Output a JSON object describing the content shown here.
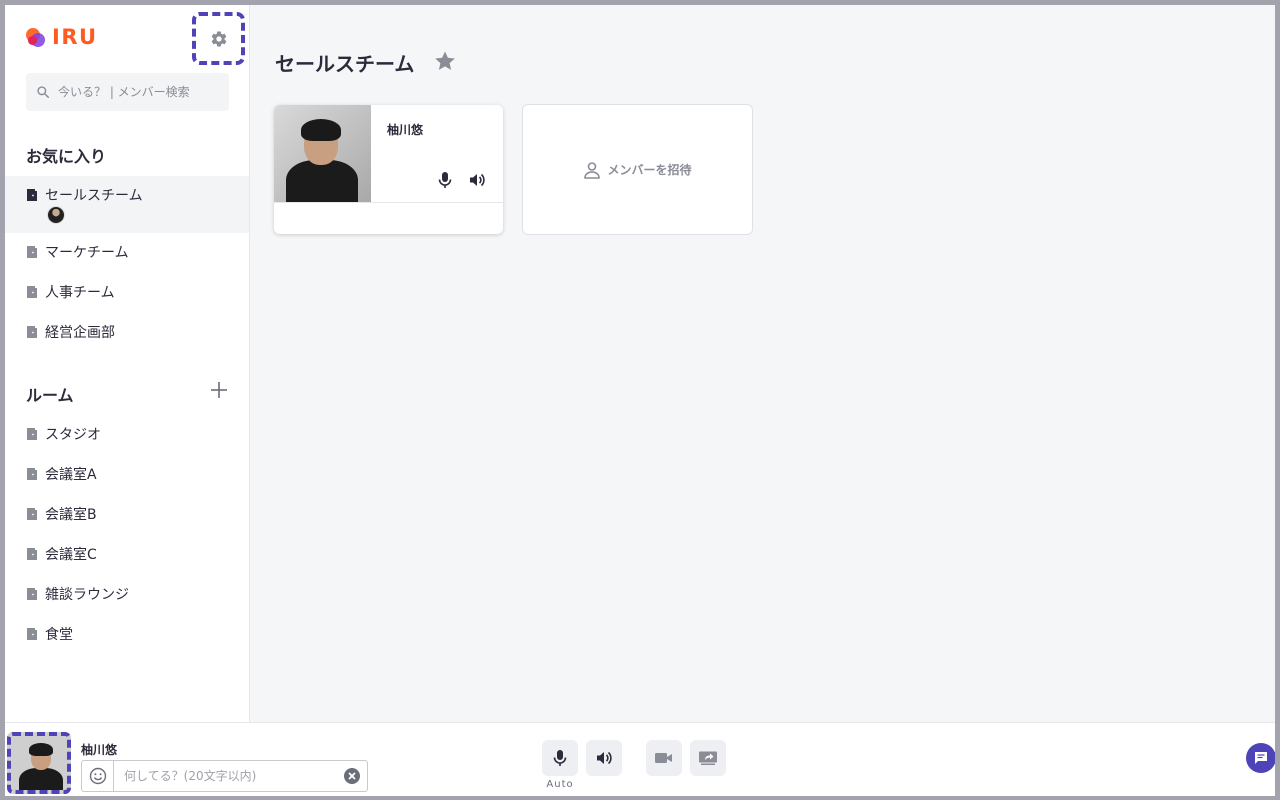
{
  "app": {
    "logo_text": "IRU",
    "brand_color": "#ff5a1f",
    "accent_color": "#4f43b8"
  },
  "sidebar": {
    "search_placeholder": "今いる？ | メンバー検索",
    "favorites_title": "お気に入り",
    "favorites": [
      {
        "label": "セールスチーム",
        "active": true
      },
      {
        "label": "マーケチーム"
      },
      {
        "label": "人事チーム"
      },
      {
        "label": "経営企画部"
      }
    ],
    "rooms_title": "ルーム",
    "rooms": [
      {
        "label": "スタジオ"
      },
      {
        "label": "会議室A"
      },
      {
        "label": "会議室B"
      },
      {
        "label": "会議室C"
      },
      {
        "label": "雑談ラウンジ"
      },
      {
        "label": "食堂"
      }
    ]
  },
  "main": {
    "room_title": "セールスチーム",
    "member": {
      "name": "柚川悠"
    },
    "invite_label": "メンバーを招待"
  },
  "bottombar": {
    "self_name": "柚川悠",
    "status_placeholder": "何してる？(20文字以内)",
    "mic_mode_label": "Auto"
  }
}
